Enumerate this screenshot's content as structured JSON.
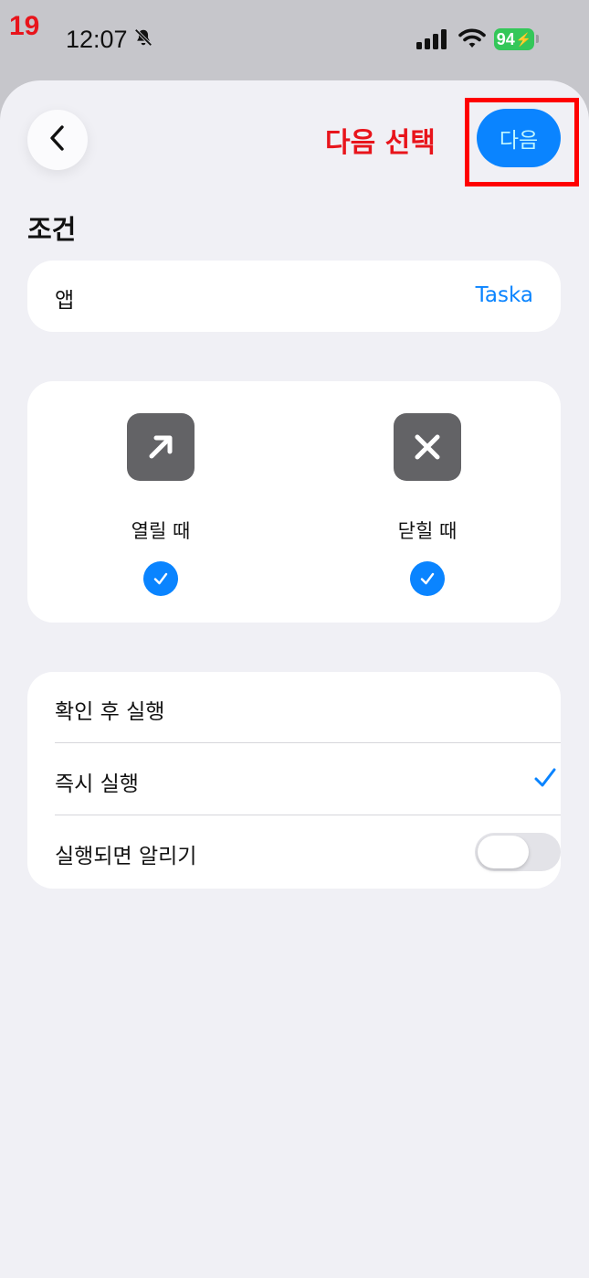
{
  "annotation": {
    "step_number": "19",
    "instruction": "다음 선택",
    "highlight_color": "#ff0000"
  },
  "status_bar": {
    "time": "12:07",
    "battery": "94",
    "icons": [
      "bell-slash-icon",
      "signal-icon",
      "wifi-icon",
      "battery-icon"
    ]
  },
  "header": {
    "back_icon": "chevron-left-icon",
    "next_label": "다음"
  },
  "section": {
    "title": "조건"
  },
  "app_row": {
    "label": "앱",
    "value": "Taska"
  },
  "triggers": [
    {
      "icon": "arrow-up-right-icon",
      "label": "열릴 때",
      "checked": true
    },
    {
      "icon": "x-mark-icon",
      "label": "닫힐 때",
      "checked": true
    }
  ],
  "options": [
    {
      "label": "확인 후 실행",
      "selected": false
    },
    {
      "label": "즉시 실행",
      "selected": true
    },
    {
      "label": "실행되면 알리기",
      "toggle_on": false
    }
  ],
  "colors": {
    "accent": "#0a84ff",
    "background": "#f0f0f5",
    "icon_tile": "#636366",
    "battery": "#34c759"
  }
}
